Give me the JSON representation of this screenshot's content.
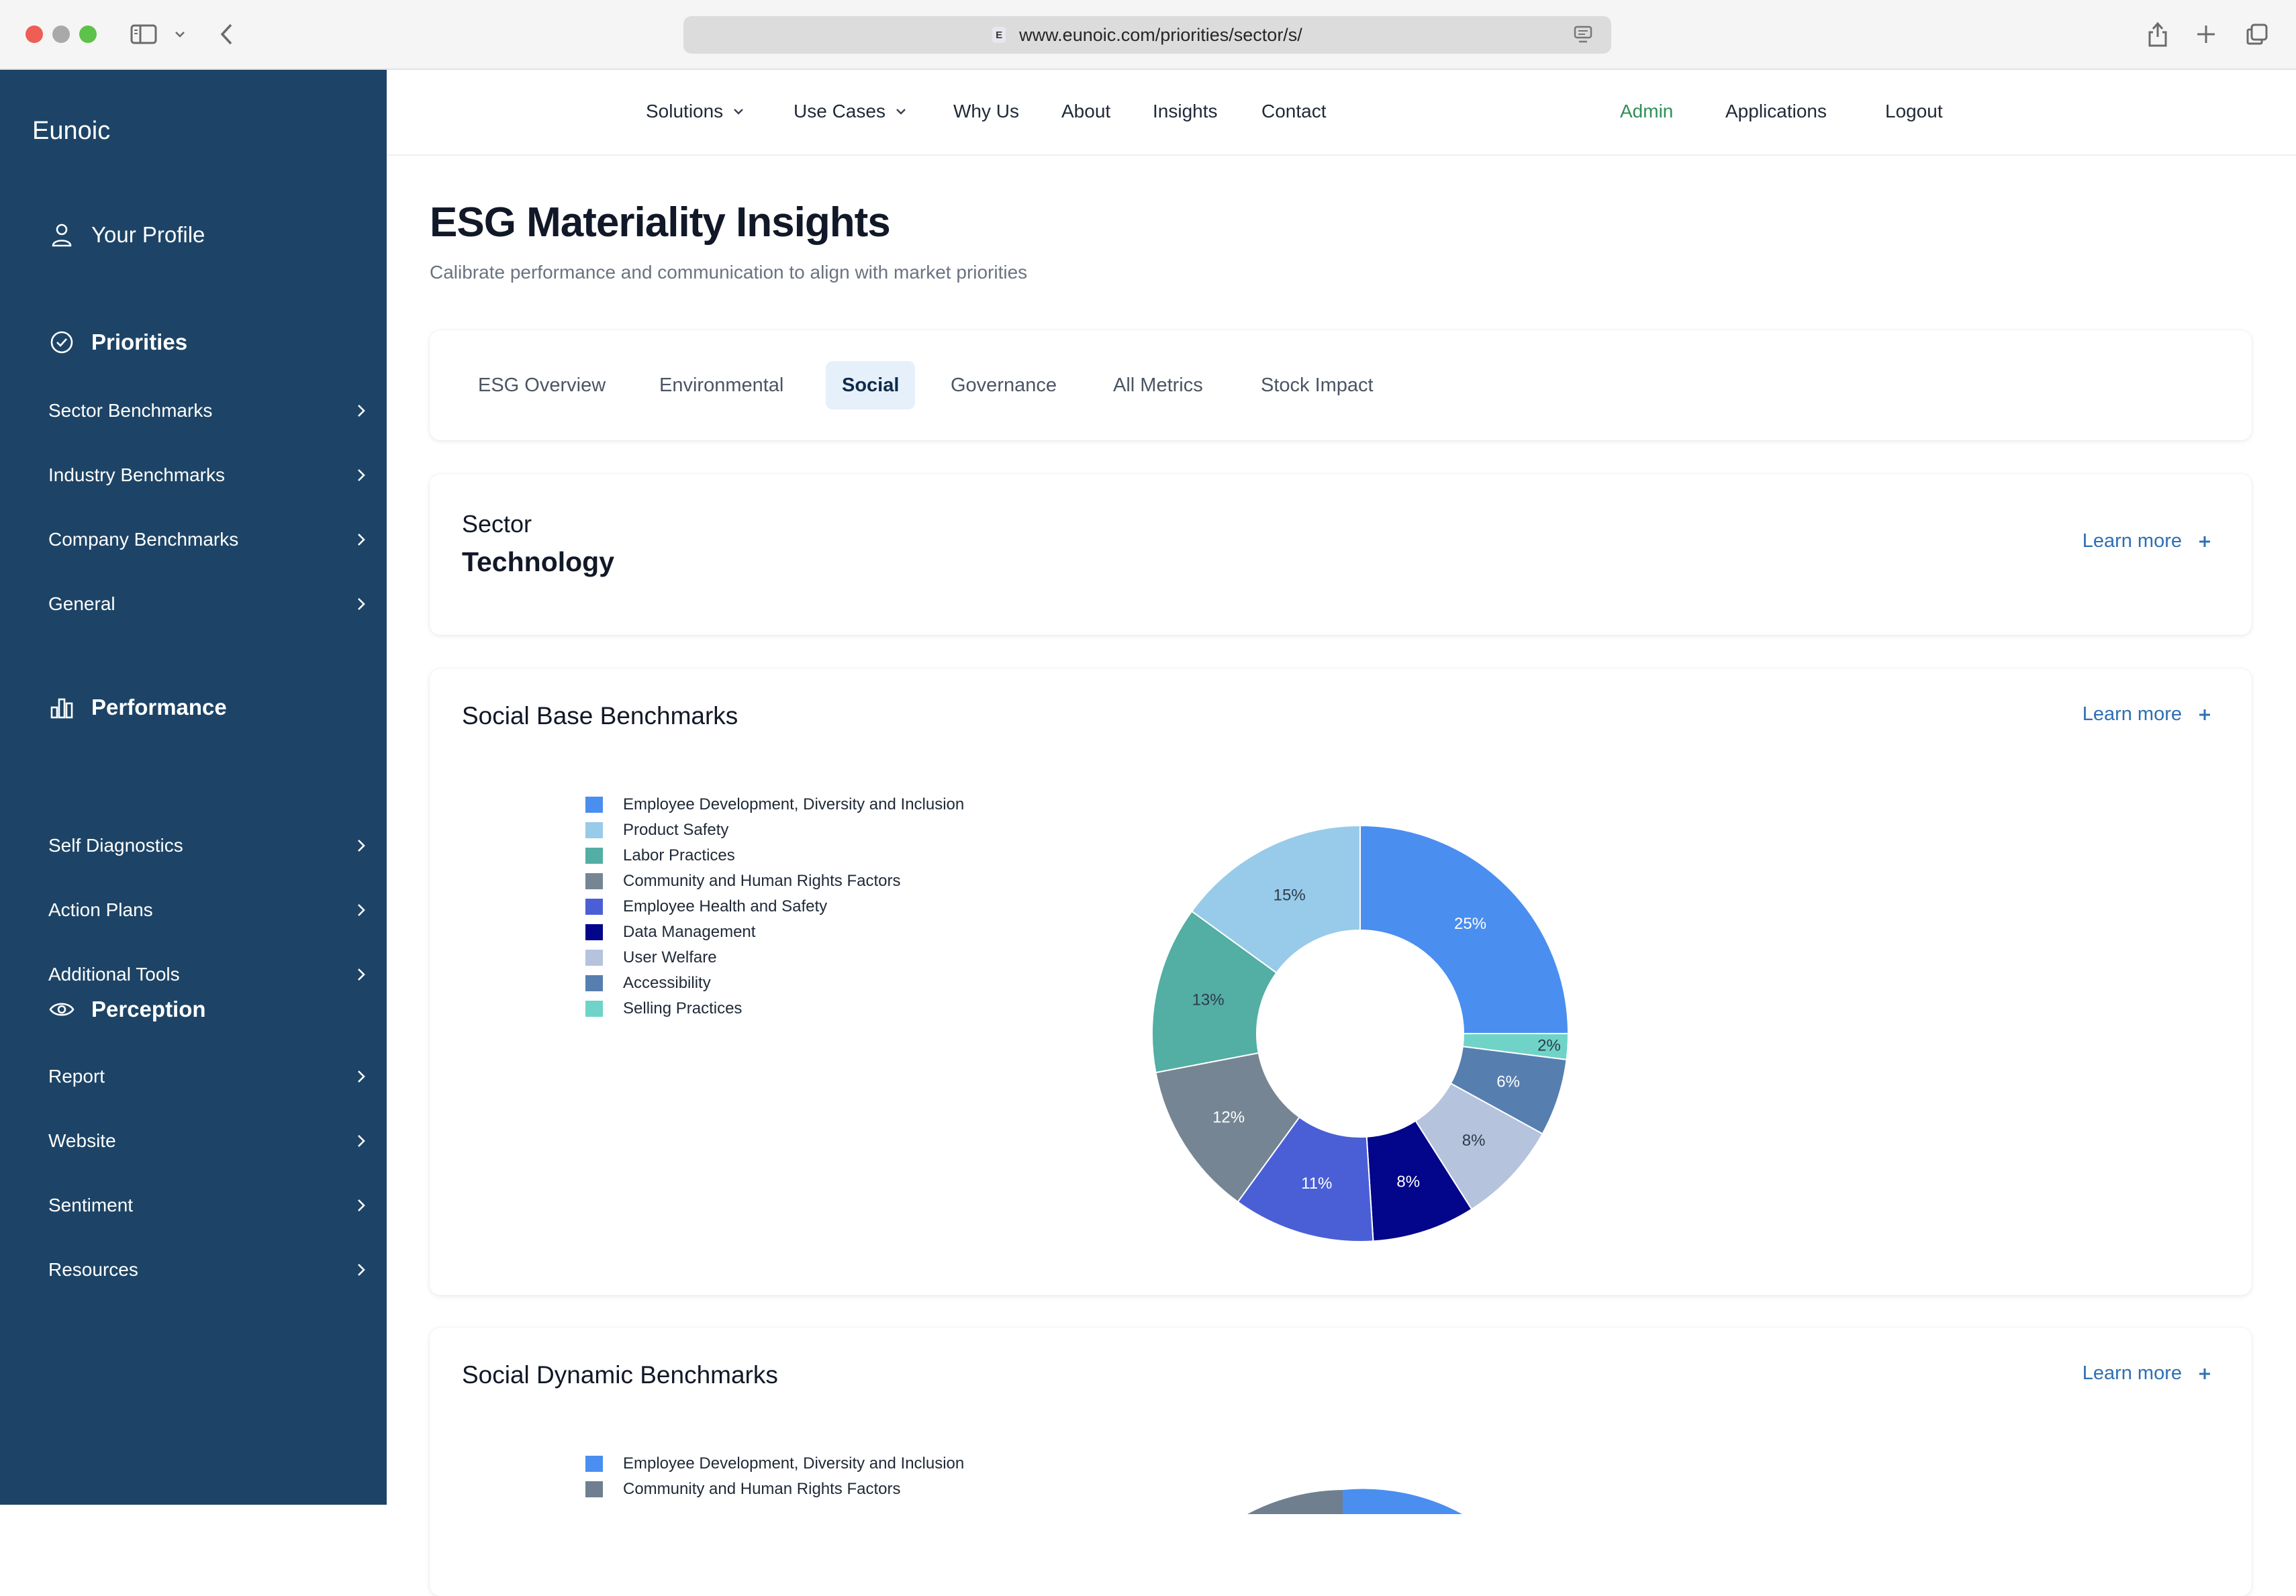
{
  "browser": {
    "url": "www.eunoic.com/priorities/sector/s/",
    "favicon_letter": "E"
  },
  "sidebar": {
    "brand": "Eunoic",
    "profile": {
      "label": "Your Profile",
      "icon": "user-icon"
    },
    "sections": [
      {
        "label": "Priorities",
        "icon": "check-circle-icon",
        "items": [
          "Sector Benchmarks",
          "Industry Benchmarks",
          "Company Benchmarks",
          "General"
        ]
      },
      {
        "label": "Performance",
        "icon": "bar-chart-icon",
        "items": [
          "Self Diagnostics",
          "Action Plans",
          "Additional Tools"
        ]
      },
      {
        "label": "Perception",
        "icon": "eye-icon",
        "items": [
          "Report",
          "Website",
          "Sentiment",
          "Resources"
        ]
      }
    ]
  },
  "topnav": {
    "left": [
      {
        "label": "Solutions",
        "dropdown": true
      },
      {
        "label": "Use Cases",
        "dropdown": true
      },
      {
        "label": "Why Us",
        "dropdown": false
      },
      {
        "label": "About",
        "dropdown": false
      },
      {
        "label": "Insights",
        "dropdown": false
      },
      {
        "label": "Contact",
        "dropdown": false
      }
    ],
    "right": [
      {
        "label": "Admin",
        "color": "#2f8f57"
      },
      {
        "label": "Applications"
      },
      {
        "label": "Logout"
      }
    ]
  },
  "page": {
    "title": "ESG Materiality Insights",
    "subtitle": "Calibrate performance and communication to align with market priorities"
  },
  "tabs": [
    {
      "label": "ESG Overview",
      "active": false
    },
    {
      "label": "Environmental",
      "active": false
    },
    {
      "label": "Social",
      "active": true
    },
    {
      "label": "Governance",
      "active": false
    },
    {
      "label": "All Metrics",
      "active": false
    },
    {
      "label": "Stock Impact",
      "active": false
    }
  ],
  "sector_card": {
    "label": "Sector",
    "value": "Technology",
    "learn_more": "Learn more"
  },
  "base_card": {
    "title": "Social Base Benchmarks",
    "learn_more": "Learn more"
  },
  "dynamic_card": {
    "title": "Social Dynamic Benchmarks",
    "learn_more": "Learn more",
    "legend": [
      {
        "label": "Employee Development, Diversity and Inclusion",
        "color": "#4a8ef0"
      },
      {
        "label": "Community and Human Rights Factors",
        "color": "#6f7f8f"
      }
    ]
  },
  "chart_data": {
    "type": "pie",
    "variant": "donut",
    "legend_position": "left",
    "categories": [
      "Employee Development, Diversity and Inclusion",
      "Product Safety",
      "Labor Practices",
      "Community and Human Rights Factors",
      "Employee Health and Safety",
      "Data Management",
      "User Welfare",
      "Accessibility",
      "Selling Practices"
    ],
    "values": [
      25,
      15,
      13,
      12,
      11,
      8,
      8,
      6,
      2
    ],
    "value_labels": [
      "25%",
      "15%",
      "13%",
      "12%",
      "11%",
      "8%",
      "8%",
      "6%",
      "2%"
    ],
    "colors": [
      "#4a8ef0",
      "#97cbe9",
      "#53aea4",
      "#768593",
      "#4a5fd6",
      "#03058a",
      "#b5c3dd",
      "#567fb0",
      "#6fd3c8"
    ],
    "label_colors": [
      "#ffffff",
      "#2d3b4a",
      "#2d3b4a",
      "#ffffff",
      "#ffffff",
      "#ffffff",
      "#2d3b4a",
      "#ffffff",
      "#2d3b4a"
    ],
    "draw_order": [
      0,
      8,
      7,
      6,
      5,
      4,
      3,
      2,
      1
    ]
  }
}
